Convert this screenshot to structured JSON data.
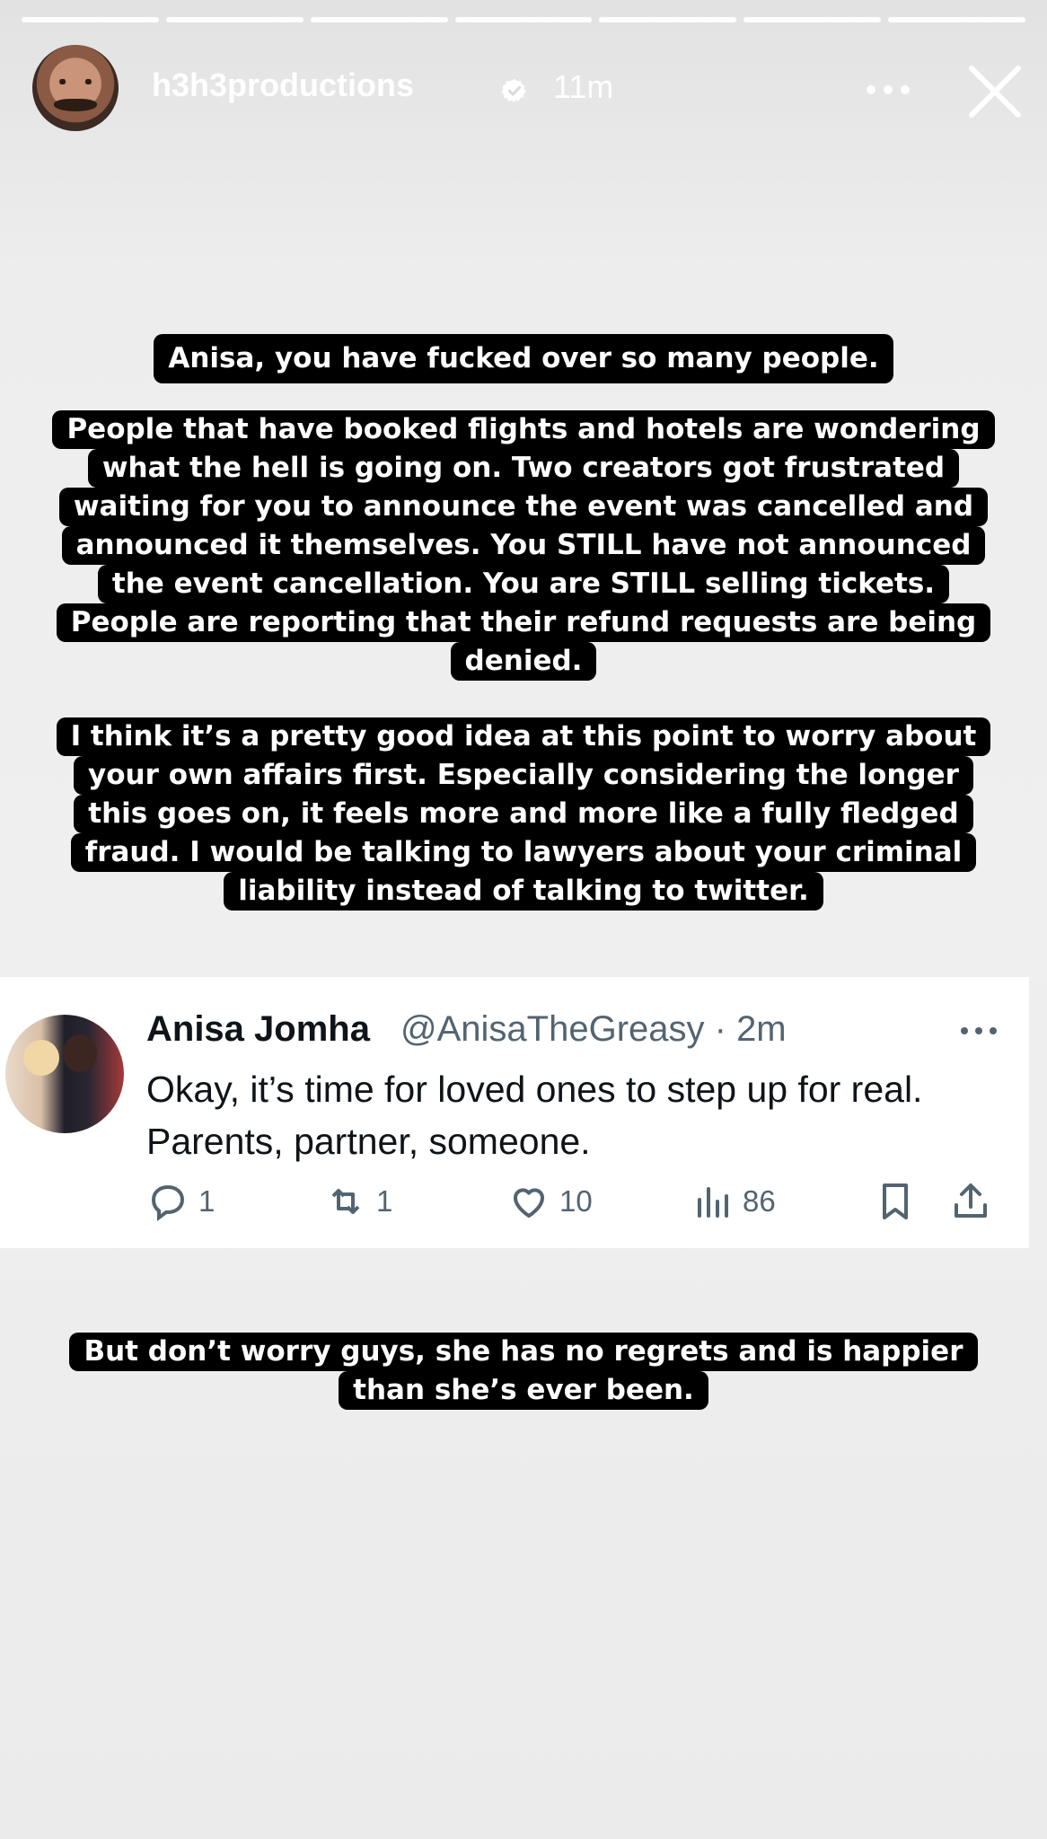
{
  "story": {
    "segments": 7,
    "username": "h3h3productions",
    "time": "11m"
  },
  "caption_top": [
    "Anisa, you have fucked over so many people."
  ],
  "caption_mid": [
    "People that have booked flights and hotels are wondering",
    "what the hell is going on. Two creators got frustrated",
    "waiting for you to announce the event was cancelled and",
    "announced it themselves. You STILL have not announced",
    "the event cancellation. You are STILL selling tickets.",
    "People are reporting that their refund requests are being",
    "denied."
  ],
  "caption_third": [
    "I think it’s a pretty good idea at this point to worry about",
    "your own affairs first. Especially considering the longer",
    "this goes on, it feels more and more like a fully fledged",
    "fraud. I would be talking to lawyers about your criminal",
    "liability instead of talking to twitter."
  ],
  "tweet": {
    "name": "Anisa Jomha",
    "handle": "@AnisaTheGreasy · 2m",
    "text_line1": "Okay, it’s time for loved ones to step up for real.",
    "text_line2": "Parents, partner, someone.",
    "replies": "1",
    "retweets": "1",
    "likes": "10",
    "views": "86"
  },
  "caption_bottom": [
    "But don’t worry guys, she has no regrets and is happier",
    "than she’s ever been."
  ],
  "colors": {
    "caption_bg": "#000000",
    "caption_text": "#ffffff",
    "tweet_secondary": "#536471"
  }
}
